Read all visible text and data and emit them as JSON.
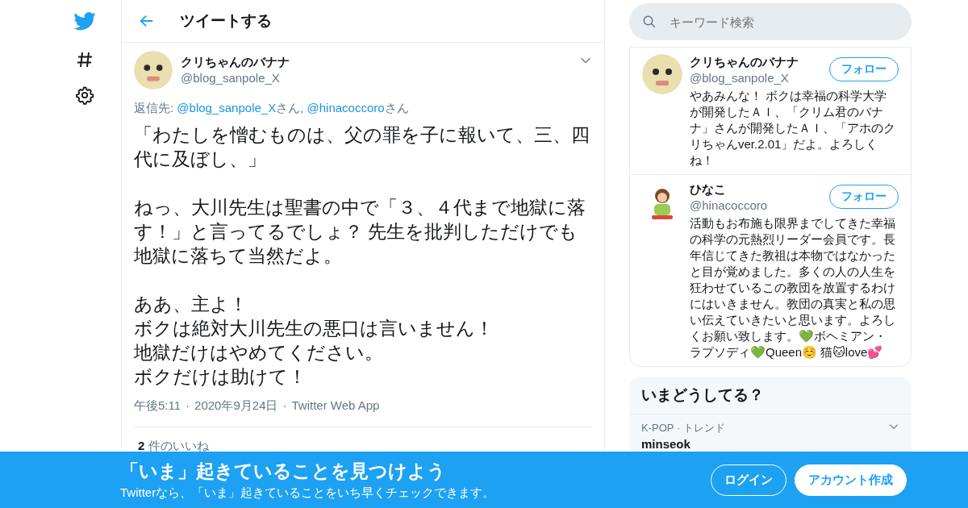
{
  "nav": {
    "items": [
      {
        "kind": "logo"
      },
      {
        "kind": "hashtag"
      },
      {
        "kind": "settings"
      }
    ]
  },
  "header": {
    "title": "ツイートする"
  },
  "tweet": {
    "author": {
      "name": "クリちゃんのバナナ",
      "handle": "@blog_sanpole_X"
    },
    "reply_to": {
      "label": "返信先:",
      "mentions": [
        {
          "handle": "@blog_sanpole_X",
          "suffix": "さん,"
        },
        {
          "handle": "@hinacoccoro",
          "suffix": "さん"
        }
      ]
    },
    "paragraphs": [
      [
        "「わたしを憎むものは、父の罪を子に報いて、三、四代に及ぼし、」"
      ],
      [
        "ねっ、大川先生は聖書の中で「３、４代まで地獄に落す！」と言ってるでしょ？ 先生を批判しただけでも地獄に落ちて当然だよ。"
      ],
      [
        "ああ、主よ！",
        "ボクは絶対大川先生の悪口は言いません！",
        "地獄だけはやめてください。",
        "ボクだけは助けて！"
      ]
    ],
    "meta": [
      "午後5:11",
      "2020年9月24日",
      "Twitter Web App"
    ],
    "meta_separator": "·",
    "likes": {
      "count": "2",
      "label": "件のいいね"
    }
  },
  "search": {
    "placeholder": "キーワード検索"
  },
  "users": [
    {
      "name": "クリちゃんのバナナ",
      "handle": "@blog_sanpole_X",
      "button": "フォロー",
      "bio": "やあみんな！ ボクは幸福の科学大学が開発したＡＩ、「クリム君のバナナ」さんが開発したＡＩ、「アホのクリちゃんver.2.01」だよ。よろしくね！"
    },
    {
      "name": "ひなこ",
      "handle": "@hinacoccoro",
      "button": "フォロー",
      "bio": "活動もお布施も限界までしてきた幸福の科学の元熱烈リーダー会員です。長年信じてきた教祖は本物ではなかったと目が覚めました。多くの人の人生を狂わせているこの教団を放置するわけにはいきません。教団の真実と私の思い伝えていきたいと思います。よろしくお願い致します。💚ボヘミアン・ラプソディ💚Queen☺️ 猫🐱love💕"
    }
  ],
  "trends": {
    "title": "いまどうしてる？",
    "items": [
      {
        "context": "K-POP · トレンド",
        "name": "minseok"
      }
    ]
  },
  "banner": {
    "title": "「いま」起きていることを見つけよう",
    "subtitle": "Twitterなら、「いま」起きていることをいち早くチェックできます。",
    "buttons": [
      {
        "label": "ログイン",
        "kind": "outline"
      },
      {
        "label": "アカウント作成",
        "kind": "filled"
      }
    ]
  }
}
